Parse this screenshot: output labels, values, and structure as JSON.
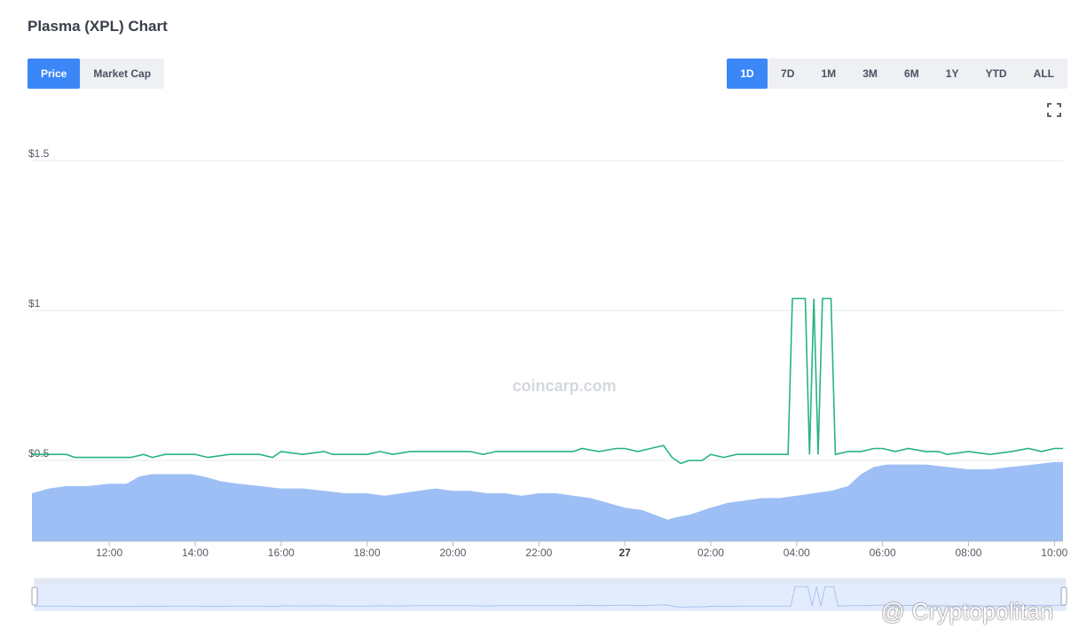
{
  "header": {
    "title": "Plasma (XPL) Chart"
  },
  "metric_tabs": [
    {
      "label": "Price",
      "active": true
    },
    {
      "label": "Market Cap",
      "active": false
    }
  ],
  "ranges": [
    {
      "label": "1D",
      "active": true
    },
    {
      "label": "7D",
      "active": false
    },
    {
      "label": "1M",
      "active": false
    },
    {
      "label": "3M",
      "active": false
    },
    {
      "label": "6M",
      "active": false
    },
    {
      "label": "1Y",
      "active": false
    },
    {
      "label": "YTD",
      "active": false
    },
    {
      "label": "ALL",
      "active": false
    }
  ],
  "icons": {
    "fullscreen": "fullscreen-icon"
  },
  "colors": {
    "line": "#27b47d",
    "volume": "#9dbff5",
    "accent": "#3b87f7"
  },
  "watermarks": {
    "chart": "coincarp.com",
    "corner": "@ Cryptopolitan"
  },
  "chart_data": {
    "type": "line",
    "y_ticks": [
      {
        "value": 0.5,
        "label": "$0.5"
      },
      {
        "value": 1,
        "label": "$1"
      },
      {
        "value": 1.5,
        "label": "$1.5"
      }
    ],
    "x_ticks": [
      {
        "hour": 12,
        "label": "12:00",
        "bold": false
      },
      {
        "hour": 14,
        "label": "14:00",
        "bold": false
      },
      {
        "hour": 16,
        "label": "16:00",
        "bold": false
      },
      {
        "hour": 18,
        "label": "18:00",
        "bold": false
      },
      {
        "hour": 20,
        "label": "20:00",
        "bold": false
      },
      {
        "hour": 22,
        "label": "22:00",
        "bold": false
      },
      {
        "hour": 24,
        "label": "27",
        "bold": true
      },
      {
        "hour": 26,
        "label": "02:00",
        "bold": false
      },
      {
        "hour": 28,
        "label": "04:00",
        "bold": false
      },
      {
        "hour": 30,
        "label": "06:00",
        "bold": false
      },
      {
        "hour": 32,
        "label": "08:00",
        "bold": false
      },
      {
        "hour": 34,
        "label": "10:00",
        "bold": false
      }
    ],
    "price_series": {
      "name": "Price",
      "points": [
        [
          10.2,
          0.52
        ],
        [
          11.0,
          0.52
        ],
        [
          11.2,
          0.51
        ],
        [
          11.6,
          0.51
        ],
        [
          12.0,
          0.51
        ],
        [
          12.5,
          0.51
        ],
        [
          12.8,
          0.52
        ],
        [
          13.0,
          0.51
        ],
        [
          13.3,
          0.52
        ],
        [
          14.0,
          0.52
        ],
        [
          14.3,
          0.51
        ],
        [
          14.8,
          0.52
        ],
        [
          15.2,
          0.52
        ],
        [
          15.5,
          0.52
        ],
        [
          15.8,
          0.51
        ],
        [
          16.0,
          0.53
        ],
        [
          16.5,
          0.52
        ],
        [
          17.0,
          0.53
        ],
        [
          17.2,
          0.52
        ],
        [
          17.6,
          0.52
        ],
        [
          18.0,
          0.52
        ],
        [
          18.3,
          0.53
        ],
        [
          18.6,
          0.52
        ],
        [
          19.0,
          0.53
        ],
        [
          19.5,
          0.53
        ],
        [
          20.0,
          0.53
        ],
        [
          20.4,
          0.53
        ],
        [
          20.7,
          0.52
        ],
        [
          21.0,
          0.53
        ],
        [
          21.5,
          0.53
        ],
        [
          22.0,
          0.53
        ],
        [
          22.4,
          0.53
        ],
        [
          22.8,
          0.53
        ],
        [
          23.0,
          0.54
        ],
        [
          23.4,
          0.53
        ],
        [
          23.8,
          0.54
        ],
        [
          24.0,
          0.54
        ],
        [
          24.3,
          0.53
        ],
        [
          24.6,
          0.54
        ],
        [
          24.9,
          0.55
        ],
        [
          25.1,
          0.51
        ],
        [
          25.3,
          0.49
        ],
        [
          25.5,
          0.5
        ],
        [
          25.8,
          0.5
        ],
        [
          26.0,
          0.52
        ],
        [
          26.3,
          0.51
        ],
        [
          26.6,
          0.52
        ],
        [
          27.0,
          0.52
        ],
        [
          27.5,
          0.52
        ],
        [
          27.8,
          0.52
        ],
        [
          27.9,
          1.04
        ],
        [
          28.2,
          1.04
        ],
        [
          28.3,
          0.52
        ],
        [
          28.4,
          1.04
        ],
        [
          28.5,
          0.52
        ],
        [
          28.6,
          1.04
        ],
        [
          28.8,
          1.04
        ],
        [
          28.9,
          0.52
        ],
        [
          29.2,
          0.53
        ],
        [
          29.5,
          0.53
        ],
        [
          29.8,
          0.54
        ],
        [
          30.0,
          0.54
        ],
        [
          30.3,
          0.53
        ],
        [
          30.6,
          0.54
        ],
        [
          31.0,
          0.53
        ],
        [
          31.3,
          0.53
        ],
        [
          31.5,
          0.52
        ],
        [
          32.0,
          0.53
        ],
        [
          32.5,
          0.52
        ],
        [
          33.0,
          0.53
        ],
        [
          33.4,
          0.54
        ],
        [
          33.7,
          0.53
        ],
        [
          34.0,
          0.54
        ],
        [
          34.2,
          0.54
        ]
      ]
    },
    "volume_series": {
      "name": "Volume",
      "points": [
        [
          10.2,
          0.2
        ],
        [
          10.6,
          0.22
        ],
        [
          11.0,
          0.23
        ],
        [
          11.5,
          0.23
        ],
        [
          12.0,
          0.24
        ],
        [
          12.4,
          0.24
        ],
        [
          12.7,
          0.27
        ],
        [
          13.0,
          0.28
        ],
        [
          13.5,
          0.28
        ],
        [
          13.9,
          0.28
        ],
        [
          14.2,
          0.27
        ],
        [
          14.6,
          0.25
        ],
        [
          15.0,
          0.24
        ],
        [
          15.5,
          0.23
        ],
        [
          16.0,
          0.22
        ],
        [
          16.5,
          0.22
        ],
        [
          17.0,
          0.21
        ],
        [
          17.5,
          0.2
        ],
        [
          18.0,
          0.2
        ],
        [
          18.4,
          0.19
        ],
        [
          18.8,
          0.2
        ],
        [
          19.2,
          0.21
        ],
        [
          19.6,
          0.22
        ],
        [
          20.0,
          0.21
        ],
        [
          20.4,
          0.21
        ],
        [
          20.8,
          0.2
        ],
        [
          21.2,
          0.2
        ],
        [
          21.6,
          0.19
        ],
        [
          22.0,
          0.2
        ],
        [
          22.4,
          0.2
        ],
        [
          22.8,
          0.19
        ],
        [
          23.2,
          0.18
        ],
        [
          23.6,
          0.16
        ],
        [
          24.0,
          0.14
        ],
        [
          24.4,
          0.13
        ],
        [
          24.7,
          0.11
        ],
        [
          25.0,
          0.09
        ],
        [
          25.2,
          0.1
        ],
        [
          25.5,
          0.11
        ],
        [
          26.0,
          0.14
        ],
        [
          26.4,
          0.16
        ],
        [
          26.8,
          0.17
        ],
        [
          27.2,
          0.18
        ],
        [
          27.6,
          0.18
        ],
        [
          28.0,
          0.19
        ],
        [
          28.4,
          0.2
        ],
        [
          28.8,
          0.21
        ],
        [
          29.2,
          0.23
        ],
        [
          29.5,
          0.28
        ],
        [
          29.8,
          0.31
        ],
        [
          30.1,
          0.32
        ],
        [
          30.5,
          0.32
        ],
        [
          31.0,
          0.32
        ],
        [
          31.5,
          0.31
        ],
        [
          32.0,
          0.3
        ],
        [
          32.5,
          0.3
        ],
        [
          33.0,
          0.31
        ],
        [
          33.5,
          0.32
        ],
        [
          34.0,
          0.33
        ],
        [
          34.2,
          0.33
        ]
      ]
    }
  }
}
